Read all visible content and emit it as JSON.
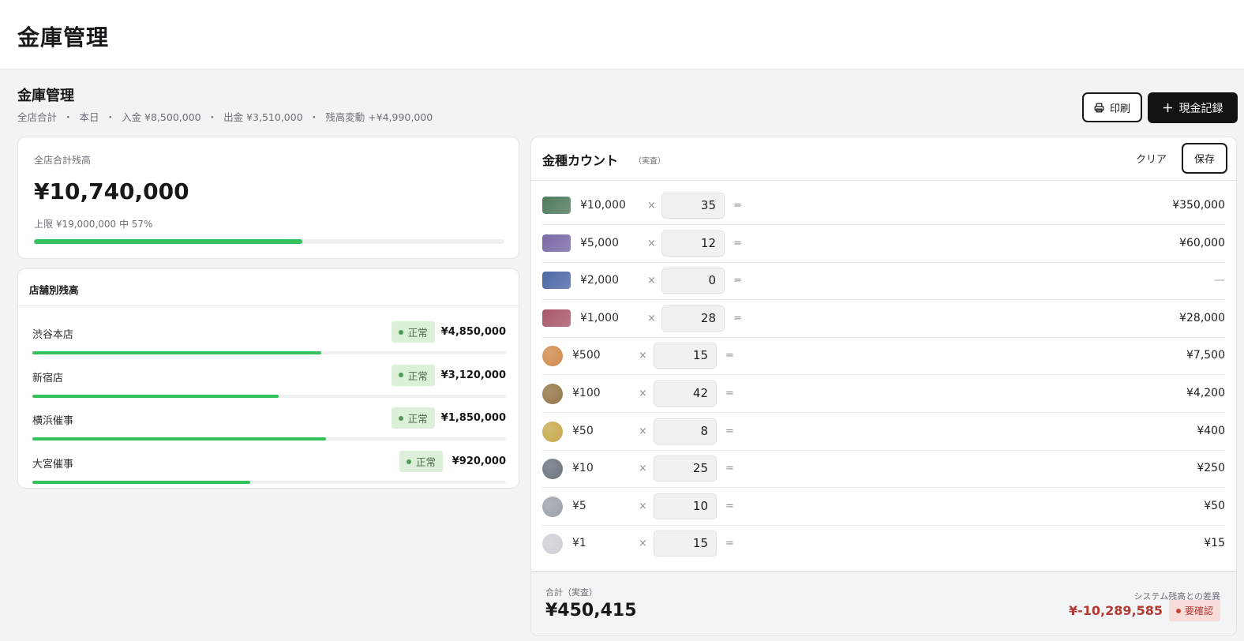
{
  "app": {
    "title": "金庫管理"
  },
  "header": {
    "title": "金庫管理",
    "summary": [
      "全店合計",
      "本日",
      "入金 ¥8,500,000",
      "出金 ¥3,510,000",
      "残高変動 +¥4,990,000"
    ],
    "summary_separator": "・",
    "print_label": "印刷",
    "new_record_label": "現金記録"
  },
  "total": {
    "label": "全店合計残高",
    "value": "¥10,740,000",
    "limit_text": "上限 ¥19,000,000 中 57%",
    "progress": 0.57
  },
  "stores": {
    "title": "店舗別残高",
    "items": [
      {
        "name": "渋谷本店",
        "status": "正常",
        "amount": "¥4,850,000",
        "progress": 0.61
      },
      {
        "name": "新宿店",
        "status": "正常",
        "amount": "¥3,120,000",
        "progress": 0.52
      },
      {
        "name": "横浜催事",
        "status": "正常",
        "amount": "¥1,850,000",
        "progress": 0.62
      },
      {
        "name": "大宮催事",
        "status": "正常",
        "amount": "¥920,000",
        "progress": 0.46
      }
    ]
  },
  "denominations": {
    "title": "金種カウント",
    "subtitle": "（実査）",
    "clear_label": "クリア",
    "save_label": "保存",
    "times": "×",
    "equals": "=",
    "rows": [
      {
        "kind": "note",
        "label": "¥10,000",
        "qty": "35",
        "subtotal": "¥350,000",
        "color": "#4f7a5c"
      },
      {
        "kind": "note",
        "label": "¥5,000",
        "qty": "12",
        "subtotal": "¥60,000",
        "color": "#7a68a6"
      },
      {
        "kind": "note",
        "label": "¥2,000",
        "qty": "0",
        "subtotal": "—",
        "color": "#4d68a6"
      },
      {
        "kind": "note",
        "label": "¥1,000",
        "qty": "28",
        "subtotal": "¥28,000",
        "color": "#a8576a"
      },
      {
        "kind": "coin",
        "label": "¥500",
        "qty": "15",
        "subtotal": "¥7,500",
        "color": "#d08a4e"
      },
      {
        "kind": "coin",
        "label": "¥100",
        "qty": "42",
        "subtotal": "¥4,200",
        "color": "#957647"
      },
      {
        "kind": "coin",
        "label": "¥50",
        "qty": "8",
        "subtotal": "¥400",
        "color": "#c7a84b"
      },
      {
        "kind": "coin",
        "label": "¥10",
        "qty": "25",
        "subtotal": "¥250",
        "color": "#6c737d"
      },
      {
        "kind": "coin",
        "label": "¥5",
        "qty": "10",
        "subtotal": "¥50",
        "color": "#9ca1a9"
      },
      {
        "kind": "coin",
        "label": "¥1",
        "qty": "15",
        "subtotal": "¥15",
        "color": "#cdd0d6"
      }
    ],
    "footer": {
      "total_label": "合計（実査）",
      "total_value": "¥450,415",
      "diff_label": "システム残高との差異",
      "diff_value": "¥-10,289,585",
      "diff_badge": "要確認"
    }
  }
}
